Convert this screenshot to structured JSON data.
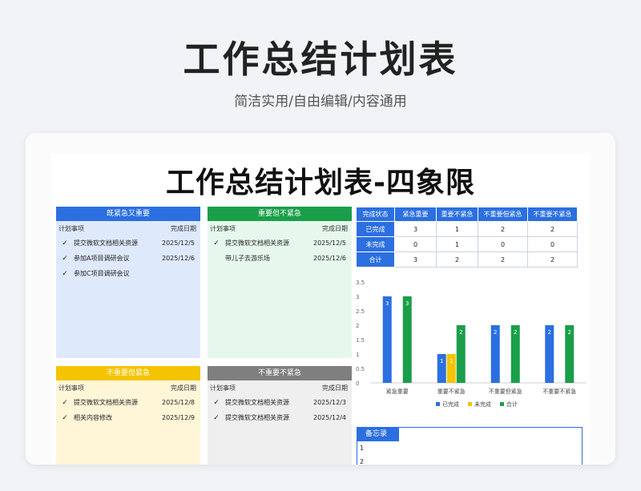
{
  "header": {
    "title": "工作总结计划表",
    "subtitle": "简洁实用/自由编辑/内容通用"
  },
  "sheet": {
    "title": "工作总结计划表-四象限"
  },
  "quadrants": [
    {
      "title": "既紧急又重要",
      "color": "#2b6fe0",
      "bg": "#dfe9fc",
      "col_task": "计划事项",
      "col_date": "完成日期",
      "tasks": [
        {
          "check": "✓",
          "name": "提交微软文档相关资源",
          "date": "2025/12/5"
        },
        {
          "check": "✓",
          "name": "参加A项目调研会议",
          "date": "2025/12/6"
        },
        {
          "check": "✓",
          "name": "参加C项目调研会议",
          "date": ""
        }
      ]
    },
    {
      "title": "重要但不紧急",
      "color": "#1a9e4a",
      "bg": "#e6f8ec",
      "col_task": "计划事项",
      "col_date": "完成日期",
      "tasks": [
        {
          "check": "✓",
          "name": "提交微软文档相关资源",
          "date": "2025/12/5"
        },
        {
          "check": "",
          "name": "带儿子去游乐场",
          "date": "2025/12/6"
        }
      ]
    },
    {
      "title": "不重要但紧急",
      "color": "#f5c400",
      "bg": "#fff6d8",
      "col_task": "计划事项",
      "col_date": "完成日期",
      "tasks": [
        {
          "check": "✓",
          "name": "提交微软文档相关资源",
          "date": "2025/12/8"
        },
        {
          "check": "✓",
          "name": "相关内容修改",
          "date": "2025/12/9"
        }
      ]
    },
    {
      "title": "不重要不紧急",
      "color": "#7f7f7f",
      "bg": "#efefef",
      "col_task": "计划事项",
      "col_date": "完成日期",
      "tasks": [
        {
          "check": "✓",
          "name": "提交微软文档相关资源",
          "date": "2025/12/3"
        },
        {
          "check": "✓",
          "name": "提交微软文档相关资源",
          "date": "2025/12/4"
        }
      ]
    }
  ],
  "status_table": {
    "headers": [
      "完成状态",
      "紧急重要",
      "重要不紧急",
      "不重要但紧急",
      "不重要不紧急"
    ],
    "rows": [
      {
        "label": "已完成",
        "values": [
          "3",
          "1",
          "2",
          "2"
        ]
      },
      {
        "label": "未完成",
        "values": [
          "0",
          "1",
          "0",
          "0"
        ]
      },
      {
        "label": "合计",
        "values": [
          "3",
          "2",
          "2",
          "2"
        ]
      }
    ]
  },
  "chart_data": {
    "type": "bar",
    "categories": [
      "紧急重要",
      "重要不紧急",
      "不重要但紧急",
      "不重要不紧急"
    ],
    "series": [
      {
        "name": "已完成",
        "color": "#2b6fe0",
        "values": [
          3,
          1,
          2,
          2
        ]
      },
      {
        "name": "未完成",
        "color": "#f5c400",
        "values": [
          0,
          1,
          0,
          0
        ]
      },
      {
        "name": "合计",
        "color": "#1a9e4a",
        "values": [
          3,
          2,
          2,
          2
        ]
      }
    ],
    "yticks": [
      "0",
      "0.5",
      "1",
      "1.5",
      "2",
      "2.5",
      "3",
      "3.5"
    ],
    "ylim": [
      0,
      3.5
    ],
    "legend": "bottom",
    "grid": false
  },
  "memo": {
    "title": "备忘录",
    "lines": [
      "1",
      "2"
    ]
  }
}
